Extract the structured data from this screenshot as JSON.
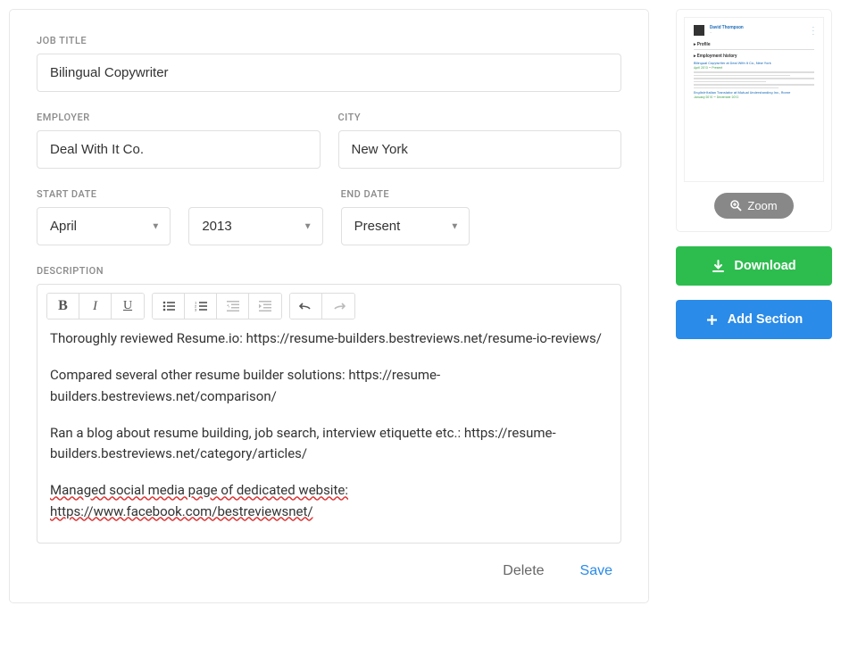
{
  "labels": {
    "jobTitle": "JOB TITLE",
    "employer": "EMPLOYER",
    "city": "CITY",
    "startDate": "START DATE",
    "endDate": "END DATE",
    "description": "DESCRIPTION"
  },
  "fields": {
    "jobTitle": "Bilingual Copywriter",
    "employer": "Deal With It Co.",
    "city": "New York",
    "startMonth": "April",
    "startYear": "2013",
    "endDate": "Present"
  },
  "description": {
    "p1a": "Thoroughly reviewed Resume.io: ",
    "p1b": "https://resume-builders.bestreviews.net/resume-io-reviews/",
    "p2a": "Compared several other resume builder solutions: ",
    "p2b": "https://resume-builders.bestreviews.net/comparison/",
    "p3a": "Ran a blog about resume building, job search, interview etiquette etc.: ",
    "p3b": "https://resume-builders.bestreviews.net/category/articles/",
    "p4a": "Managed social media page of dedicated website: ",
    "p4b": "https://www.facebook.com/bestreviewsnet/"
  },
  "actions": {
    "delete": "Delete",
    "save": "Save",
    "zoom": "Zoom",
    "download": "Download",
    "addSection": "Add Section"
  },
  "preview": {
    "name": "David Thompson",
    "profile": "Profile",
    "employment": "Employment history",
    "job1": "Bilingual Copywriter at Deal With It Co., New York",
    "job1date_a": "April 2013",
    "dash": " — ",
    "job1date_b": "Present",
    "job2": "English-Italian Translator at Mutual Understanding Inc., Rome",
    "job2date_a": "January 2010",
    "job2date_b": "December 2012"
  }
}
